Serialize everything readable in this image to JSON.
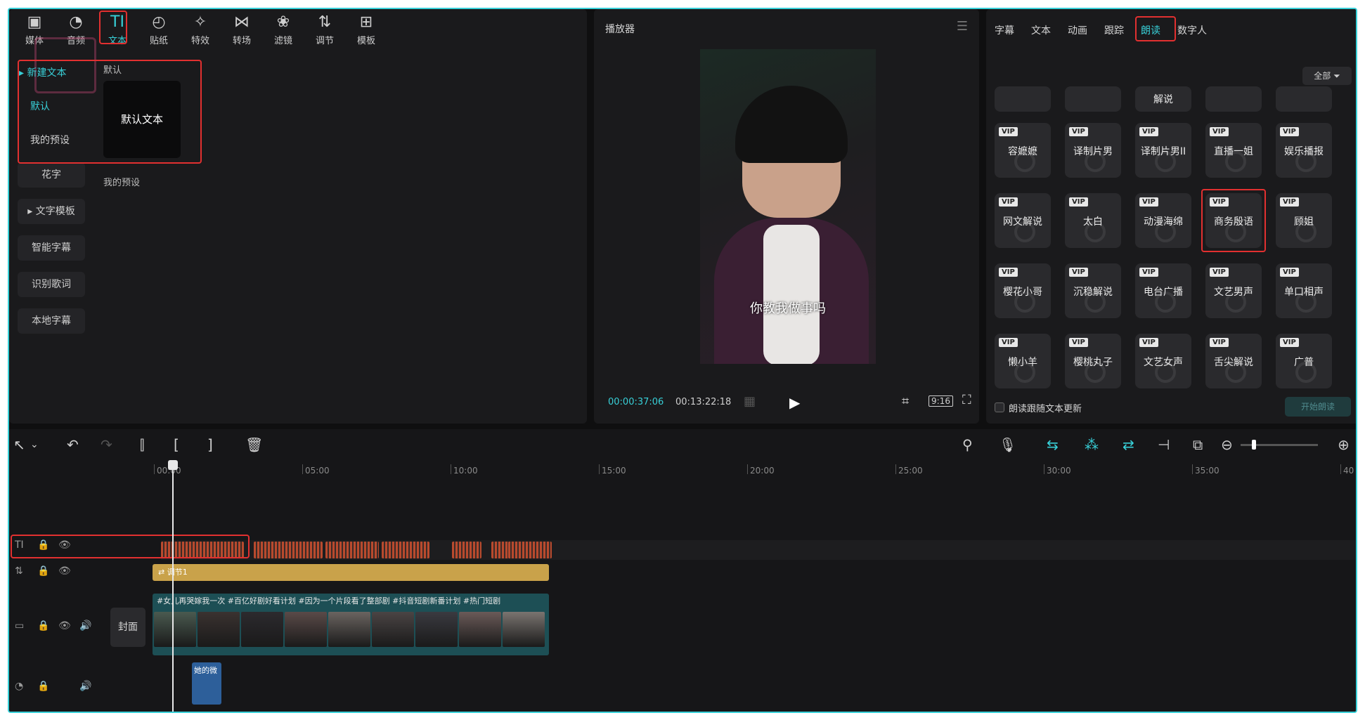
{
  "toolbar": {
    "items": [
      {
        "label": "媒体",
        "icon": "media-icon"
      },
      {
        "label": "音频",
        "icon": "audio-icon"
      },
      {
        "label": "文本",
        "icon": "text-icon"
      },
      {
        "label": "贴纸",
        "icon": "sticker-icon"
      },
      {
        "label": "特效",
        "icon": "effects-icon"
      },
      {
        "label": "转场",
        "icon": "transition-icon"
      },
      {
        "label": "滤镜",
        "icon": "filter-icon"
      },
      {
        "label": "调节",
        "icon": "adjust-icon"
      },
      {
        "label": "模板",
        "icon": "template-icon"
      }
    ],
    "active": "文本"
  },
  "text_sidebar": {
    "expanded_group": "新建文本",
    "sub_items": [
      "默认",
      "我的预设"
    ],
    "items": [
      "花字",
      "文字模板",
      "智能字幕",
      "识别歌词",
      "本地字幕"
    ]
  },
  "text_content": {
    "section_default": "默认",
    "default_card": "默认文本",
    "section_preset": "我的预设"
  },
  "player": {
    "title": "播放器",
    "subtitle": "你教我做事吗",
    "current_time": "00:00:37:06",
    "total_time": "00:13:22:18",
    "ratio": "9:16"
  },
  "right_panel": {
    "tabs": [
      "字幕",
      "文本",
      "动画",
      "跟踪",
      "朗读",
      "数字人"
    ],
    "active_tab": "朗读",
    "filter_label": "全部",
    "top_row_partial": [
      "",
      "",
      "解说",
      "",
      ""
    ],
    "voices": [
      [
        "容嬷嬷",
        "译制片男",
        "译制片男II",
        "直播一姐",
        "娱乐播报"
      ],
      [
        "网文解说",
        "太白",
        "动漫海绵",
        "商务殷语",
        "顾姐"
      ],
      [
        "樱花小哥",
        "沉稳解说",
        "电台广播",
        "文艺男声",
        "单口相声"
      ],
      [
        "懒小羊",
        "樱桃丸子",
        "文艺女声",
        "舌尖解说",
        "广普"
      ]
    ],
    "vip_label": "VIP",
    "checkbox_label": "朗读跟随文本更新",
    "start_button": "开始朗读"
  },
  "timeline": {
    "ticks": [
      "00:00",
      "05:00",
      "10:00",
      "15:00",
      "20:00",
      "25:00",
      "30:00",
      "35:00",
      "40"
    ],
    "adjust_clip_label": "调节1",
    "video_clip_caption": "#女儿再哭嫁我一次 #百亿好剧好看计划 #因为一个片段看了整部剧 #抖音短剧新番计划 #热门短剧",
    "cover_label": "封面",
    "audio_clip_label": "她的微"
  },
  "colors": {
    "accent": "#38d0d8",
    "highlight_box": "#e23030",
    "adjust_clip": "#c9a24a",
    "text_clip": "#b84a2e"
  }
}
